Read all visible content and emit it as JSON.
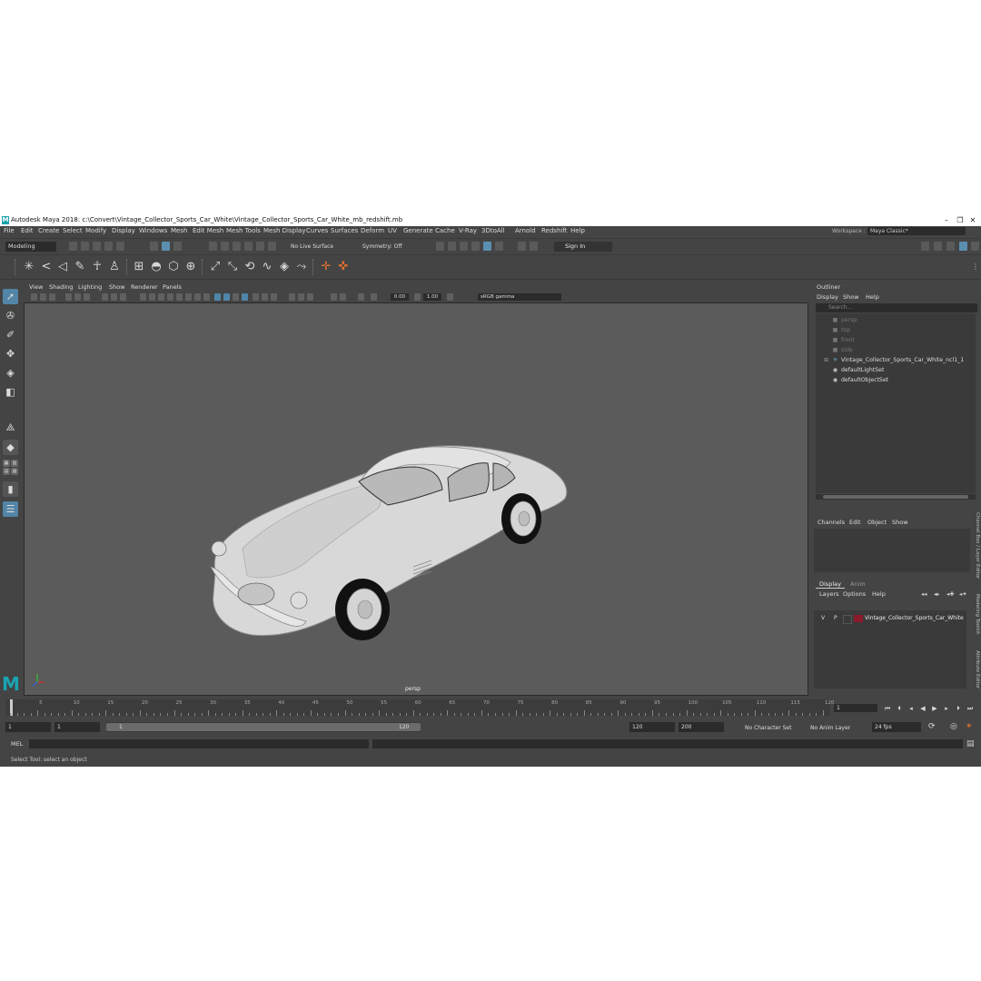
{
  "window": {
    "title": "Autodesk Maya 2018: c:\\Convert\\Vintage_Collector_Sports_Car_White\\Vintage_Collector_Sports_Car_White_mb_redshift.mb",
    "logo": "M",
    "minimize": "–",
    "maximize": "❐",
    "close": "✕"
  },
  "menubar": {
    "items": [
      "File",
      "Edit",
      "Create",
      "Select",
      "Modify",
      "Display",
      "Windows",
      "Mesh",
      "Edit Mesh",
      "Mesh Tools",
      "Mesh Display",
      "Curves",
      "Surfaces",
      "Deform",
      "UV",
      "Generate",
      "Cache",
      "V-Ray",
      "3DtoAll",
      "Arnold",
      "Redshift",
      "Help"
    ],
    "workspace_label": "Workspace :",
    "workspace_value": "Maya Classic*"
  },
  "statusline": {
    "mode": "Modeling",
    "live_surface": "No Live Surface",
    "symmetry": "Symmetry: Off",
    "sign_in": "Sign In"
  },
  "viewport": {
    "menu": [
      "View",
      "Shading",
      "Lighting",
      "Show",
      "Renderer",
      "Panels"
    ],
    "exposure": "0.00",
    "gamma": "1.00",
    "color_space": "sRGB gamma",
    "camera_label": "persp",
    "logo": "M"
  },
  "outliner": {
    "title": "Outliner",
    "menu": [
      "Display",
      "Show",
      "Help"
    ],
    "search_placeholder": "Search...",
    "items": [
      {
        "label": "persp",
        "dim": true
      },
      {
        "label": "top",
        "dim": true
      },
      {
        "label": "front",
        "dim": true
      },
      {
        "label": "side",
        "dim": true
      },
      {
        "label": "Vintage_Collector_Sports_Car_White_ncl1_1",
        "dim": false
      },
      {
        "label": "defaultLightSet",
        "dim": false
      },
      {
        "label": "defaultObjectSet",
        "dim": false
      }
    ]
  },
  "channelbox": {
    "menu": [
      "Channels",
      "Edit",
      "Object",
      "Show"
    ]
  },
  "layers": {
    "tabs": [
      "Display",
      "Anim"
    ],
    "menu": [
      "Layers",
      "Options",
      "Help"
    ],
    "row": {
      "v": "V",
      "p": "P",
      "name": "Vintage_Collector_Sports_Car_White",
      "color": "#8a1a2a"
    }
  },
  "side_tabs": [
    "Channel Box / Layer Editor",
    "Modeling Toolkit",
    "Attribute Editor"
  ],
  "timeline": {
    "ticks": [
      "5",
      "10",
      "15",
      "20",
      "25",
      "30",
      "35",
      "40",
      "45",
      "50",
      "55",
      "60",
      "65",
      "70",
      "75",
      "80",
      "85",
      "90",
      "95",
      "100",
      "105",
      "110",
      "115",
      "120"
    ],
    "current_frame": "1"
  },
  "range": {
    "start": "1",
    "playback_start": "1",
    "slider_start": "1",
    "slider_end": "120",
    "playback_end": "120",
    "end": "200",
    "character_set": "No Character Set",
    "anim_layer": "No Anim Layer",
    "fps": "24 fps"
  },
  "commandline": {
    "label": "MEL",
    "help": "Select Tool: select an object"
  },
  "colors": {
    "accent": "#5285a6",
    "maya_teal": "#1aa3b0",
    "layer_color": "#8a1a2a"
  }
}
